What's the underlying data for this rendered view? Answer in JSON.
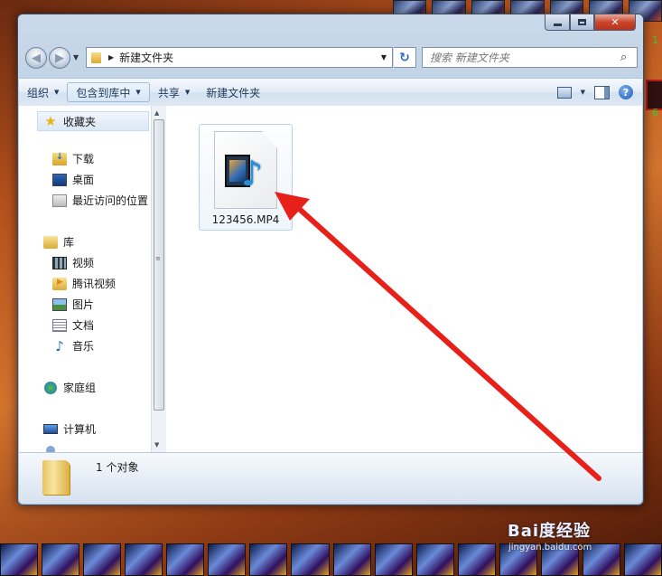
{
  "window": {
    "caption_buttons": {
      "minimize": "minimize",
      "maximize": "maximize",
      "close": "✕"
    }
  },
  "navbar": {
    "back_icon": "back-arrow-icon",
    "forward_icon": "forward-arrow-icon",
    "address_path": "新建文件夹",
    "refresh_glyph": "↻",
    "search_placeholder": "搜索 新建文件夹",
    "search_glyph": "⌕"
  },
  "toolbar": {
    "organize": "组织",
    "include_in_library": "包含到库中",
    "share": "共享",
    "new_folder": "新建文件夹",
    "help_glyph": "?"
  },
  "sidebar": {
    "favorites": {
      "label": "收藏夹",
      "items": [
        {
          "label": "下载",
          "icon": "download-folder-icon"
        },
        {
          "label": "桌面",
          "icon": "desktop-icon"
        },
        {
          "label": "最近访问的位置",
          "icon": "recent-places-icon"
        }
      ]
    },
    "libraries": {
      "label": "库",
      "items": [
        {
          "label": "视频",
          "icon": "video-library-icon"
        },
        {
          "label": "腾讯视频",
          "icon": "tencent-video-icon"
        },
        {
          "label": "图片",
          "icon": "pictures-library-icon"
        },
        {
          "label": "文档",
          "icon": "documents-library-icon"
        },
        {
          "label": "音乐",
          "icon": "music-library-icon"
        }
      ]
    },
    "homegroup": {
      "label": "家庭组"
    },
    "computer": {
      "label": "计算机"
    }
  },
  "files": [
    {
      "name": "123456.MP4",
      "icon": "mp4-video-file-icon"
    }
  ],
  "details": {
    "count_text": "1 个对象"
  },
  "watermark": {
    "text": "Bai度经验",
    "url": "jingyan.baidu.com"
  },
  "colors": {
    "arrow": "#e8201a"
  }
}
